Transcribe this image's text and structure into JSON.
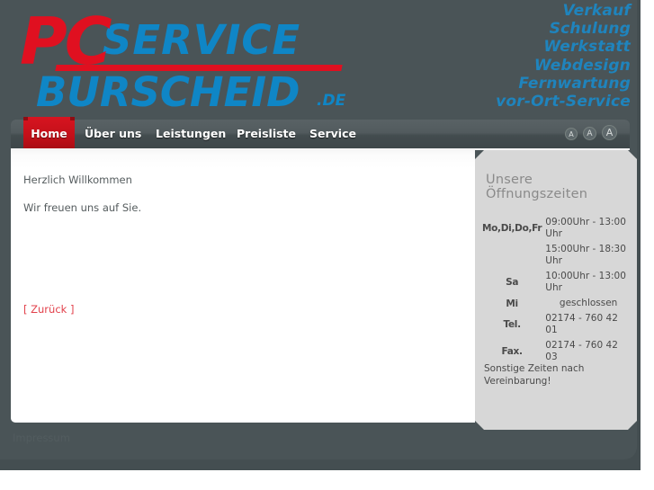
{
  "logo": {
    "pc": "PC",
    "service": "SERVICE",
    "burscheid": "BURSCHEID",
    "tld": ".DE",
    "colors": {
      "red": "#e01020",
      "blue": "#0f86c6"
    }
  },
  "header": {
    "services": [
      "Verkauf",
      "Schulung",
      "Werkstatt",
      "Webdesign",
      "Fernwartung",
      "vor-Ort-Service"
    ]
  },
  "nav": {
    "active": "Home",
    "items": [
      {
        "label": "Home",
        "active": true
      },
      {
        "label": "Über uns",
        "active": false
      },
      {
        "label": "Leistungen",
        "active": false
      },
      {
        "label": "Preisliste",
        "active": false
      },
      {
        "label": "Service",
        "active": false
      }
    ],
    "font_size_buttons": [
      {
        "label": "A",
        "size": "small"
      },
      {
        "label": "A",
        "size": "medium"
      },
      {
        "label": "A",
        "size": "large"
      }
    ]
  },
  "main": {
    "paragraphs": [
      "Herzlich Willkommen",
      "Wir freuen uns auf Sie."
    ],
    "back_link": "[ Zurück ]"
  },
  "sidebar": {
    "title": "Unsere Öffnungszeiten",
    "rows": [
      {
        "label": "Mo,Di,Do,Fr",
        "value": "09:00Uhr - 13:00 Uhr",
        "centered": false
      },
      {
        "label": "",
        "value": "15:00Uhr - 18:30 Uhr",
        "centered": false
      },
      {
        "label": "Sa",
        "value": "10:00Uhr - 13:00 Uhr",
        "centered": false
      },
      {
        "label": "Mi",
        "value": "geschlossen",
        "centered": true
      },
      {
        "label": "Tel.",
        "value": "02174 - 760 42 01",
        "centered": false
      },
      {
        "label": "Fax.",
        "value": "02174 - 760 42 03",
        "centered": false
      }
    ],
    "note": "Sonstige Zeiten nach Vereinbarung!"
  },
  "footer": {
    "impressum": "Impressum"
  }
}
